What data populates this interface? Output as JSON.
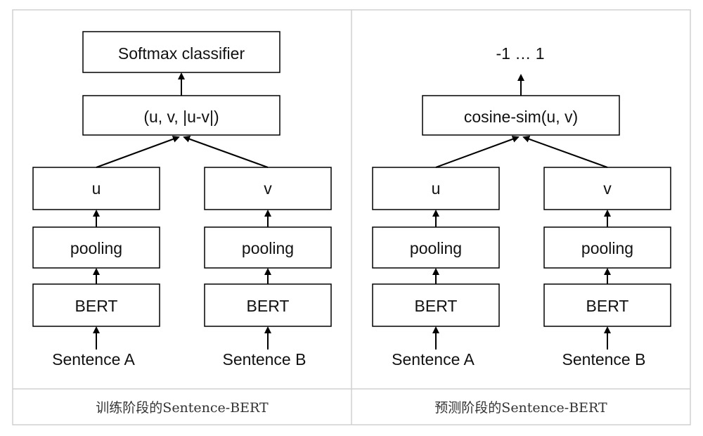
{
  "panels": [
    {
      "top_label": "Softmax classifier",
      "combine_label": "(u, v, |u-v|)",
      "left": {
        "embedding": "u",
        "pooling": "pooling",
        "encoder": "BERT",
        "input": "Sentence A"
      },
      "right": {
        "embedding": "v",
        "pooling": "pooling",
        "encoder": "BERT",
        "input": "Sentence B"
      },
      "caption": "训练阶段的Sentence-BERT"
    },
    {
      "top_label": "-1 … 1",
      "combine_label": "cosine-sim(u, v)",
      "left": {
        "embedding": "u",
        "pooling": "pooling",
        "encoder": "BERT",
        "input": "Sentence A"
      },
      "right": {
        "embedding": "v",
        "pooling": "pooling",
        "encoder": "BERT",
        "input": "Sentence B"
      },
      "caption": "预测阶段的Sentence-BERT"
    }
  ]
}
